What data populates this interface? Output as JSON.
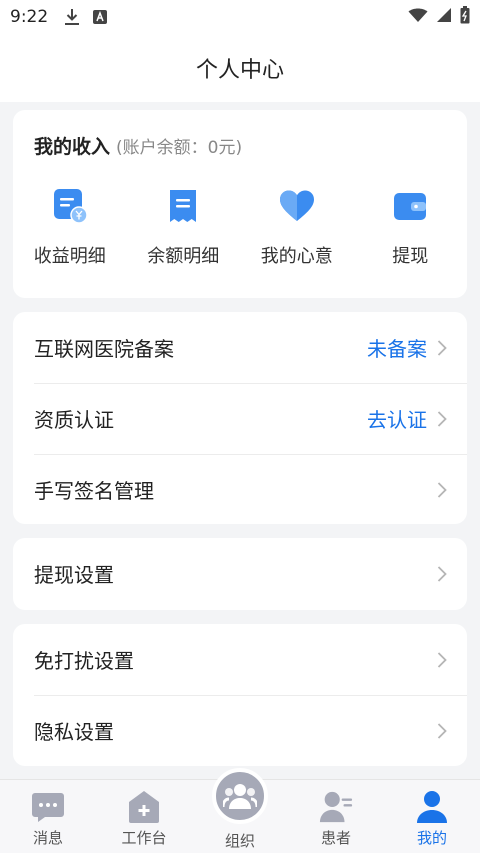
{
  "status_bar": {
    "time": "9:22"
  },
  "header": {
    "title": "个人中心"
  },
  "income": {
    "title": "我的收入",
    "balance": "(账户余额：0元)",
    "items": [
      {
        "label": "收益明细",
        "icon": "income-detail-icon"
      },
      {
        "label": "余额明细",
        "icon": "receipt-icon"
      },
      {
        "label": "我的心意",
        "icon": "heart-icon"
      },
      {
        "label": "提现",
        "icon": "wallet-icon"
      }
    ]
  },
  "menu_group_1": [
    {
      "label": "互联网医院备案",
      "value": "未备案"
    },
    {
      "label": "资质认证",
      "value": "去认证"
    },
    {
      "label": "手写签名管理",
      "value": ""
    }
  ],
  "menu_group_2": [
    {
      "label": "提现设置"
    }
  ],
  "menu_group_3": [
    {
      "label": "免打扰设置"
    },
    {
      "label": "隐私设置"
    }
  ],
  "tabbar": {
    "active": "我的",
    "tabs": [
      {
        "label": "消息",
        "icon": "message-icon"
      },
      {
        "label": "工作台",
        "icon": "workbench-icon"
      },
      {
        "label": "组织",
        "icon": "organization-icon"
      },
      {
        "label": "患者",
        "icon": "patient-icon"
      },
      {
        "label": "我的",
        "icon": "profile-icon"
      }
    ]
  },
  "colors": {
    "accent": "#1a73e8",
    "icon_blue": "#3b8cf0",
    "inactive_icon": "#a6a9b7"
  }
}
